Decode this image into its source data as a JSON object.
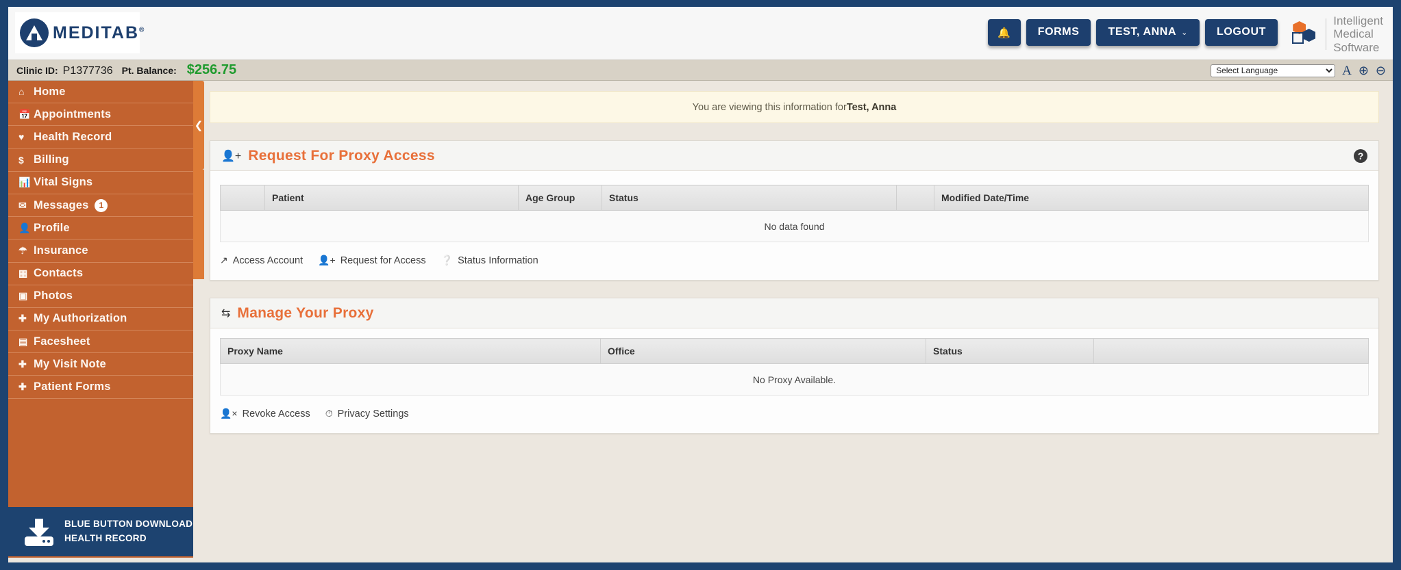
{
  "header": {
    "logo_word": "MEDITAB",
    "logo_reg": "®",
    "buttons": [
      {
        "label": "\u0001",
        "name": "notifications"
      },
      {
        "label": "FORMS",
        "name": "forms"
      },
      {
        "label": "TEST, ANNA",
        "name": "user-menu",
        "caret": "⌄"
      },
      {
        "label": "LOGOUT",
        "name": "logout"
      }
    ],
    "bell_icon": "bell-icon",
    "ims_text_line1": "Intelligent",
    "ims_text_line2": "Medical",
    "ims_text_line3": "Software"
  },
  "subbar": {
    "clinic_label": "Clinic ID:",
    "clinic_value": "P1377736",
    "balance_label": "Pt. Balance:",
    "balance_value": "$256.75",
    "balance_color": "#1f9b2e",
    "language_selected": "Select Language",
    "language_options": [
      "Select Language"
    ],
    "font_size_icon": "A",
    "zoom_in_icon": "⊕",
    "zoom_out_icon": "⊖"
  },
  "sidebar": {
    "collapse_icon": "❮",
    "items": [
      {
        "label": "Home",
        "icon": "⌂",
        "icon_name": "home-icon"
      },
      {
        "label": "Appointments",
        "icon": "▦",
        "icon_name": "calendar-icon"
      },
      {
        "label": "Health Record",
        "icon": "♥",
        "icon_name": "heartbeat-icon"
      },
      {
        "label": "Billing",
        "icon": "$",
        "icon_name": "dollar-icon"
      },
      {
        "label": "Vital Signs",
        "icon": "▮▮",
        "icon_name": "bar-chart-icon"
      },
      {
        "label": "Messages",
        "icon": "✉",
        "icon_name": "envelope-icon",
        "badge": "1"
      },
      {
        "label": "Profile",
        "icon": "👤",
        "icon_name": "user-icon"
      },
      {
        "label": "Insurance",
        "icon": "☂",
        "icon_name": "umbrella-icon"
      },
      {
        "label": "Contacts",
        "icon": "▤",
        "icon_name": "address-card-icon"
      },
      {
        "label": "Photos",
        "icon": "▣",
        "icon_name": "image-icon"
      },
      {
        "label": "My Authorization",
        "icon": "✛",
        "icon_name": "plus-square-icon"
      },
      {
        "label": "Facesheet",
        "icon": "▤",
        "icon_name": "file-icon"
      },
      {
        "label": "My Visit Note",
        "icon": "✛",
        "icon_name": "plus-square-icon"
      },
      {
        "label": "Patient Forms",
        "icon": "✛",
        "icon_name": "plus-square-icon"
      }
    ],
    "blue_button": {
      "line1": "BLUE BUTTON DOWNLOAD",
      "line2": "HEALTH RECORD",
      "icon_name": "download-icon"
    }
  },
  "main": {
    "alert": {
      "prefix": "You are viewing this information for ",
      "patient": "Test, Anna"
    },
    "proxy_request_panel": {
      "title": "Request For Proxy Access",
      "title_icon": "user-plus-icon",
      "help_icon": "?",
      "columns": [
        "",
        "Patient",
        "Age Group",
        "Status",
        "",
        "Modified Date/Time"
      ],
      "empty_message": "No data found",
      "links": [
        {
          "label": "Access Account",
          "icon": "↗",
          "icon_name": "external-link-icon"
        },
        {
          "label": "Request for Access",
          "icon": "👤",
          "icon_name": "user-plus-icon"
        },
        {
          "label": "Status Information",
          "icon": "?",
          "icon_name": "question-circle-icon"
        }
      ]
    },
    "manage_proxy_panel": {
      "title": "Manage Your Proxy",
      "title_icon": "exchange-icon",
      "columns": [
        "Proxy Name",
        "Office",
        "Status",
        ""
      ],
      "empty_message": "No Proxy Available.",
      "links": [
        {
          "label": "Revoke Access",
          "icon": "👤",
          "icon_name": "user-times-icon"
        },
        {
          "label": "Privacy Settings",
          "icon": "◕",
          "icon_name": "clock-icon"
        }
      ]
    }
  },
  "colors": {
    "navy": "#1d4370",
    "orange": "#c2622f",
    "accent_orange": "#e8703a",
    "page_bg": "#ece7df"
  }
}
